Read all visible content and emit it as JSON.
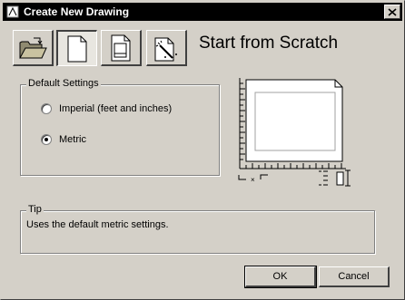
{
  "window": {
    "title": "Create New Drawing"
  },
  "toolbar": {
    "buttons": [
      {
        "icon": "open-folder-icon",
        "selected": false
      },
      {
        "icon": "blank-page-icon",
        "selected": true
      },
      {
        "icon": "template-page-icon",
        "selected": false
      },
      {
        "icon": "wizard-page-icon",
        "selected": false
      }
    ]
  },
  "heading": "Start from Scratch",
  "default_settings": {
    "label": "Default Settings",
    "options": [
      {
        "label": "Imperial (feet and inches)",
        "checked": false
      },
      {
        "label": "Metric",
        "checked": true
      }
    ]
  },
  "tip": {
    "label": "Tip",
    "text": "Uses the default metric settings."
  },
  "actions": {
    "ok_label": "OK",
    "cancel_label": "Cancel"
  }
}
